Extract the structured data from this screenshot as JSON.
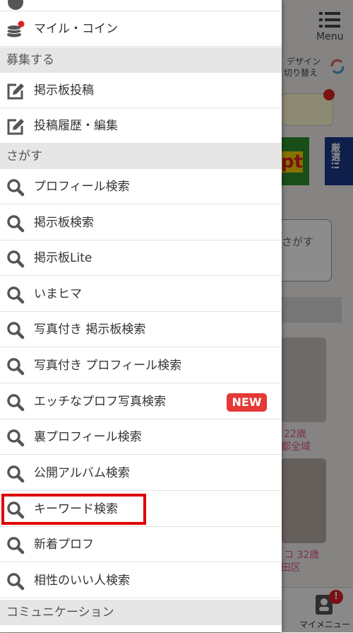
{
  "background": {
    "menu_label": "Menu",
    "design_switch": [
      "デザイン",
      "切り替え"
    ],
    "banner_text_1": "pt",
    "banner_text_2": "厳選!!",
    "search_box_text": "さがす",
    "profile1": [
      "22歳",
      "都全域"
    ],
    "profile2": [
      "コ 32歳",
      "田区"
    ],
    "my_menu_label": "マイメニュー",
    "notif_count": "!"
  },
  "drawer": {
    "top_item": {
      "label": "マイル・コイン",
      "icon": "coins-icon"
    },
    "sections": [
      {
        "title": "募集する",
        "items": [
          {
            "label": "掲示板投稿",
            "icon": "edit-icon"
          },
          {
            "label": "投稿履歴・編集",
            "icon": "edit-icon"
          }
        ]
      },
      {
        "title": "さがす",
        "items": [
          {
            "label": "プロフィール検索",
            "icon": "search-icon"
          },
          {
            "label": "掲示板検索",
            "icon": "search-icon"
          },
          {
            "label": "掲示板Lite",
            "icon": "search-icon"
          },
          {
            "label": "いまヒマ",
            "icon": "search-icon"
          },
          {
            "label": "写真付き 掲示板検索",
            "icon": "search-icon"
          },
          {
            "label": "写真付き プロフィール検索",
            "icon": "search-icon"
          },
          {
            "label": "エッチなプロフ写真検索",
            "icon": "search-icon",
            "badge": "NEW"
          },
          {
            "label": "裏プロフィール検索",
            "icon": "search-icon"
          },
          {
            "label": "公開アルバム検索",
            "icon": "search-icon"
          },
          {
            "label": "キーワード検索",
            "icon": "search-icon",
            "highlighted": true
          },
          {
            "label": "新着プロフ",
            "icon": "search-icon"
          },
          {
            "label": "相性のいい人検索",
            "icon": "search-icon"
          }
        ]
      },
      {
        "title": "コミュニケーション",
        "items": []
      }
    ]
  },
  "colors": {
    "badge_red": "#e53936",
    "highlight_red": "#e00000",
    "icon_gray": "#555555"
  }
}
